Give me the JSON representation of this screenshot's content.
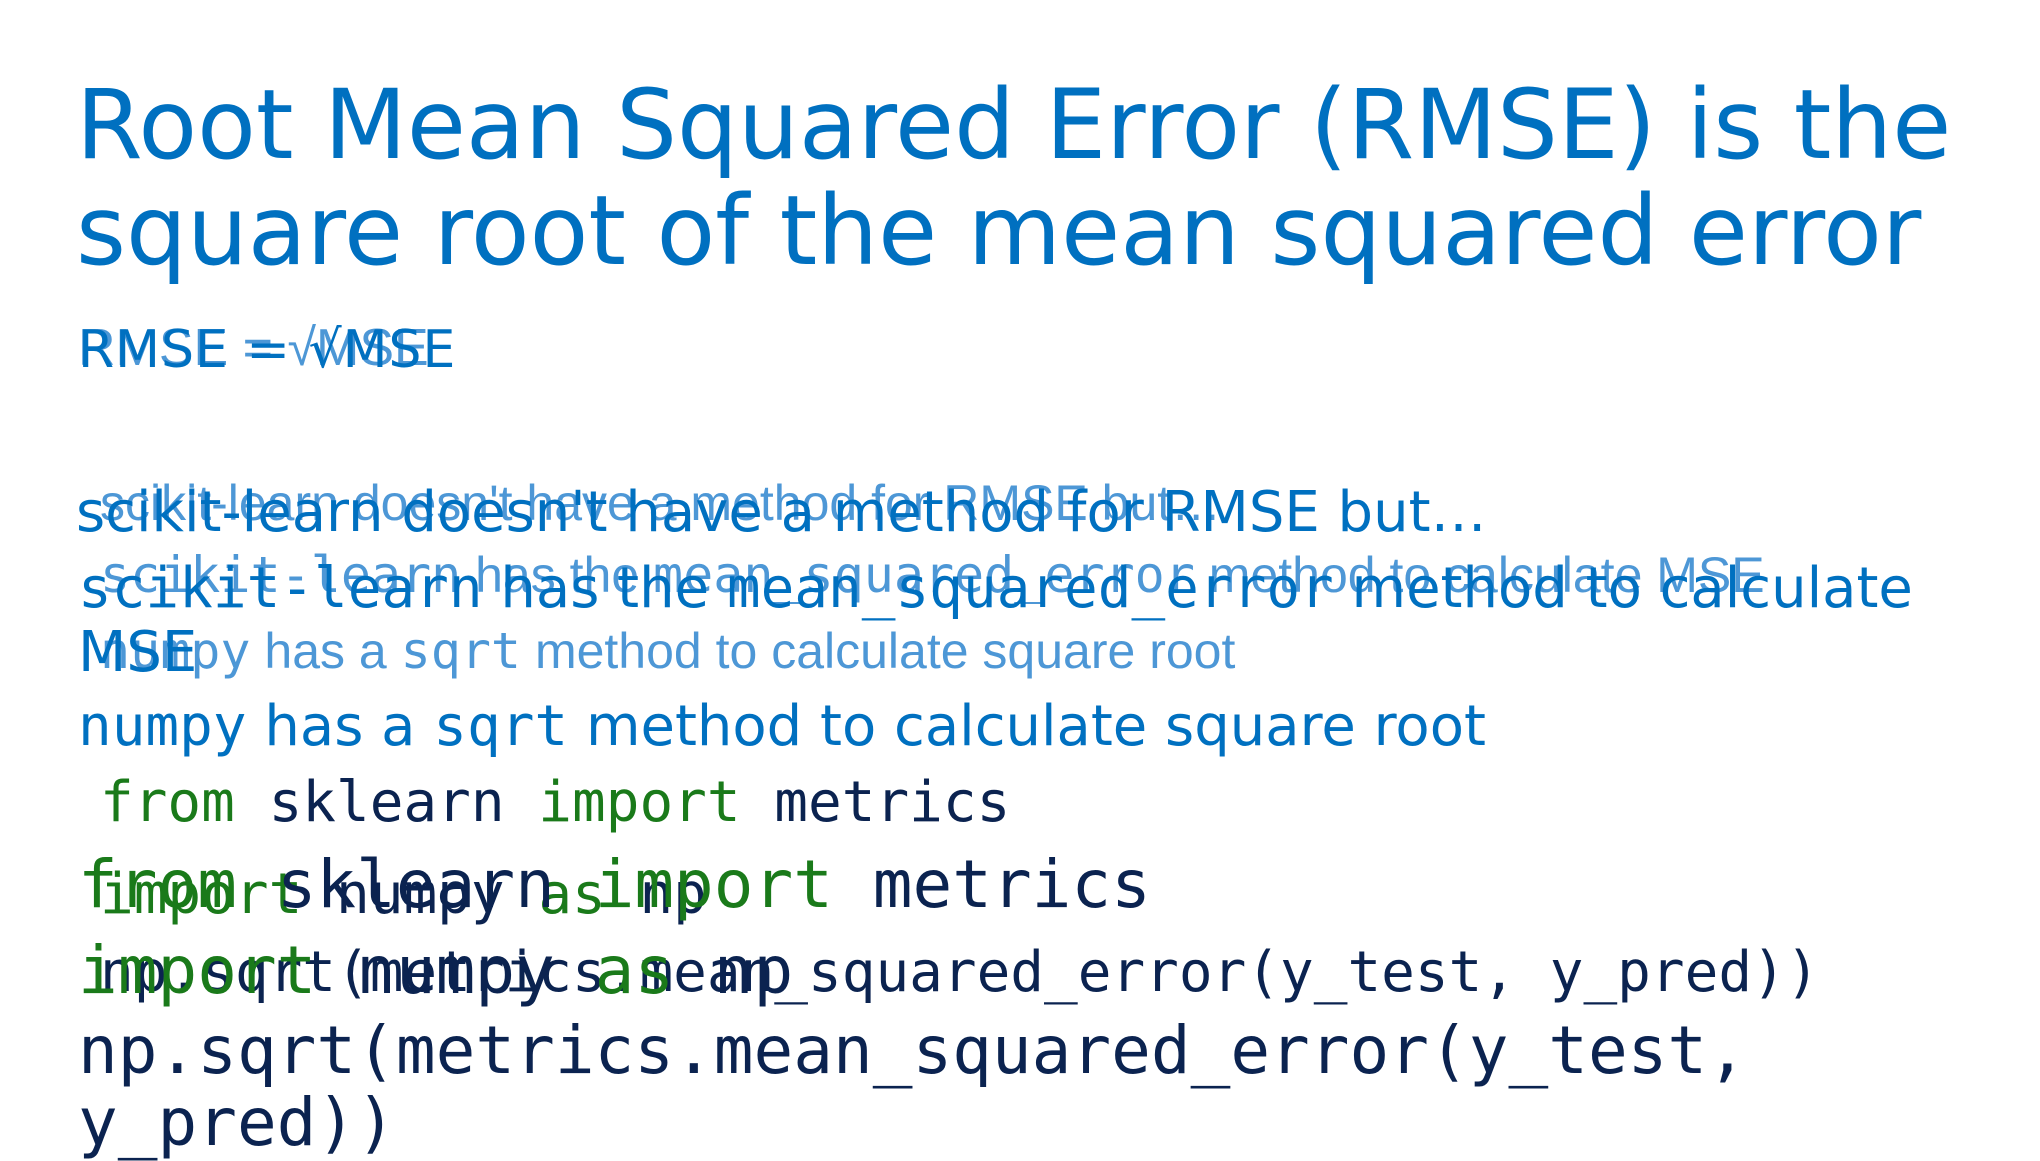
{
  "back_layer": {
    "formula": "RMSE = √MSE",
    "note": "scikit-learn doesn't have a method for RMSE but…",
    "mse_prefix": "scikit-learn",
    "mse_mid": " has the ",
    "mse_fn": "mean_squared_error",
    "mse_suffix": " method to calculate MSE",
    "sqrt_lib": "numpy",
    "sqrt_mid": " has a ",
    "sqrt_fn": "sqrt",
    "sqrt_suffix": " method to calculate square root",
    "code_line1_kw1": "from",
    "code_line1_mod": " sklearn ",
    "code_line1_kw2": "import",
    "code_line1_name": " metrics",
    "code_line2_kw1": "import",
    "code_line2_mod": " numpy ",
    "code_line2_kw2": "as",
    "code_line2_alias": " np",
    "code_line3": "np.sqrt(metrics.mean_squared_error(y_test, y_pred))"
  },
  "front_layer": {
    "title": "Root Mean Squared Error (RMSE) is the square root of the mean squared error",
    "formula": "RMSE = √MSE",
    "note": "scikit-learn doesn't have a method for RMSE but…",
    "mse_prefix": "scikit-learn",
    "mse_mid": " has the ",
    "mse_fn": "mean_squared_error",
    "mse_suffix": " method to calculate",
    "mse_wrap": "MSE",
    "sqrt_lib": "numpy",
    "sqrt_mid": " has a ",
    "sqrt_fn": "sqrt",
    "sqrt_suffix": " method to calculate square root",
    "code_line1_kw1": "from",
    "code_line1_mod": " sklearn ",
    "code_line1_kw2": "import",
    "code_line1_name": " metrics",
    "code_line2_kw1": "import",
    "code_line2_mod": " numpy ",
    "code_line2_kw2": "as",
    "code_line2_alias": " np",
    "code_line3a": "np.sqrt(metrics.mean_squared_error(y_test,",
    "code_line3b": "y_pred))"
  },
  "colors": {
    "title_blue": "#0070c0",
    "code_navy": "#0b2350",
    "keyword_green": "#1a7a1a"
  }
}
